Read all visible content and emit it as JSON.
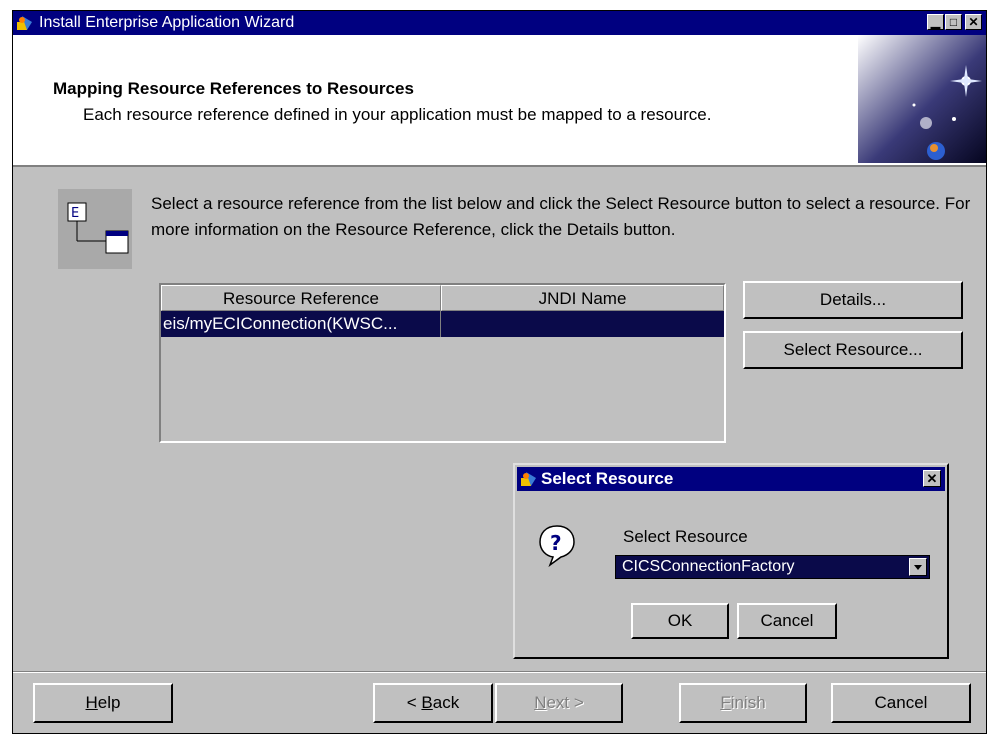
{
  "window": {
    "title": "Install Enterprise Application Wizard",
    "controls": {
      "minimize": "▁",
      "maximize": "□",
      "close": "✕"
    }
  },
  "header": {
    "title": "Mapping Resource References to Resources",
    "subtitle": "Each resource reference defined in your application must be mapped to a resource.",
    "graphic_icon": "starfield-graphic"
  },
  "description": {
    "icon": "resource-mapping-icon",
    "text": "Select a resource reference from the list below and click the Select Resource button to select a resource. For more information on the Resource Reference, click the Details button."
  },
  "table": {
    "columns": [
      "Resource Reference",
      "JNDI Name"
    ],
    "rows": [
      {
        "resource_reference": "eis/myECIConnection(KWSC...",
        "jndi_name": ""
      }
    ]
  },
  "side_buttons": {
    "details": "Details...",
    "select_resource": "Select Resource..."
  },
  "dialog": {
    "title": "Select Resource",
    "close": "✕",
    "icon": "question-icon",
    "label": "Select Resource",
    "selected_value": "CICSConnectionFactory",
    "ok": "OK",
    "cancel": "Cancel"
  },
  "footer": {
    "help": {
      "mnemonic": "H",
      "rest": "elp"
    },
    "back": {
      "prefix": "< ",
      "mnemonic": "B",
      "rest": "ack"
    },
    "next": {
      "mnemonic": "N",
      "rest": "ext >"
    },
    "finish": {
      "mnemonic": "F",
      "rest": "inish"
    },
    "cancel": "Cancel"
  },
  "colors": {
    "title_bar": "#000080",
    "window_face": "#c0c0c0",
    "selection": "#0a0a4a"
  }
}
